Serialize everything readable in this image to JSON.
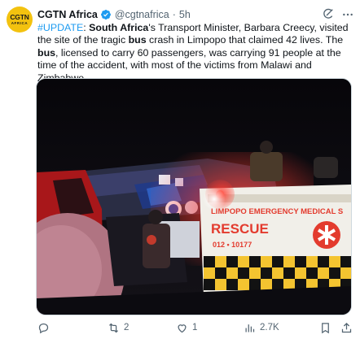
{
  "tweet": {
    "avatar_line1": "CGTN",
    "avatar_line2": "AFRICA",
    "display_name": "CGTN Africa",
    "handle": "@cgtnafrica",
    "separator": "·",
    "time": "5h",
    "text_parts": {
      "hashtag": "#UPDATE",
      "p1": ": ",
      "b1": "South Africa",
      "p2": "'s Transport Minister, Barbara Creecy, visited the site of the tragic ",
      "b2": "bus",
      "p3": " crash in Limpopo that claimed 42 lives. The ",
      "b3": "bus",
      "p4": ", licensed to carry 60 passengers, was carrying 91 people at the time of the accident, with most of the victims from Malawi and Zimbabwe."
    }
  },
  "media": {
    "ambulance_line1": "LIMPOPO EMERGENCY MEDICAL S",
    "ambulance_line2": "RESCUE",
    "ambulance_number": "012 •  10177"
  },
  "actions": {
    "replies": "",
    "reposts": "2",
    "likes": "1",
    "views": "2.7K"
  },
  "icons": [
    "verified-icon",
    "grok-icon",
    "more-icon",
    "reply-icon",
    "repost-icon",
    "like-icon",
    "views-icon",
    "bookmark-icon",
    "share-icon"
  ],
  "colors": {
    "link": "#1d9bf0",
    "text": "#0f1419",
    "muted": "#536471",
    "brand": "#f3c20f"
  }
}
